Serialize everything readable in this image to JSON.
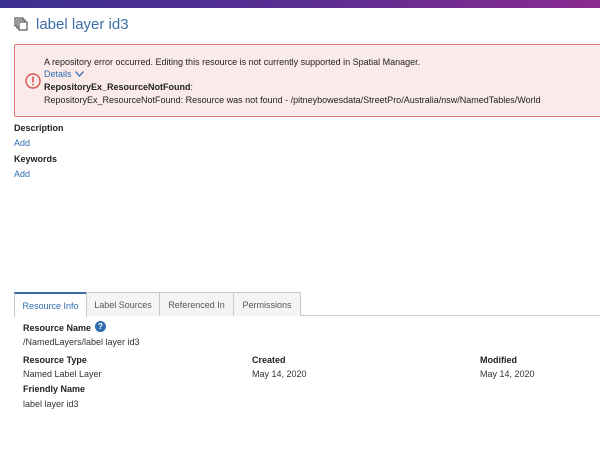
{
  "header": {
    "title": "label layer id3",
    "icon": "layers-icon"
  },
  "error": {
    "message": "A repository error occurred. Editing this resource is not currently supported in Spatial Manager.",
    "details_label": "Details",
    "code": "RepositoryEx_ResourceNotFound",
    "code_suffix": ":",
    "detail": "RepositoryEx_ResourceNotFound: Resource was not found - /pitneybowesdata/StreetPro/Australia/nsw/NamedTables/World",
    "color": "#d9534f"
  },
  "description": {
    "label": "Description",
    "add_label": "Add"
  },
  "keywords": {
    "label": "Keywords",
    "add_label": "Add"
  },
  "tabs": [
    {
      "label": "Resource Info",
      "active": true
    },
    {
      "label": "Label Sources",
      "active": false
    },
    {
      "label": "Referenced In",
      "active": false
    },
    {
      "label": "Permissions",
      "active": false
    }
  ],
  "resource_info": {
    "name_label": "Resource Name",
    "help_glyph": "?",
    "name_value": "/NamedLayers/label layer id3",
    "type_label": "Resource Type",
    "type_value": "Named Label Layer",
    "created_label": "Created",
    "created_value": "May 14, 2020",
    "modified_label": "Modified",
    "modified_value": "May 14, 2020",
    "friendly_label": "Friendly Name",
    "friendly_value": "label layer id3"
  }
}
